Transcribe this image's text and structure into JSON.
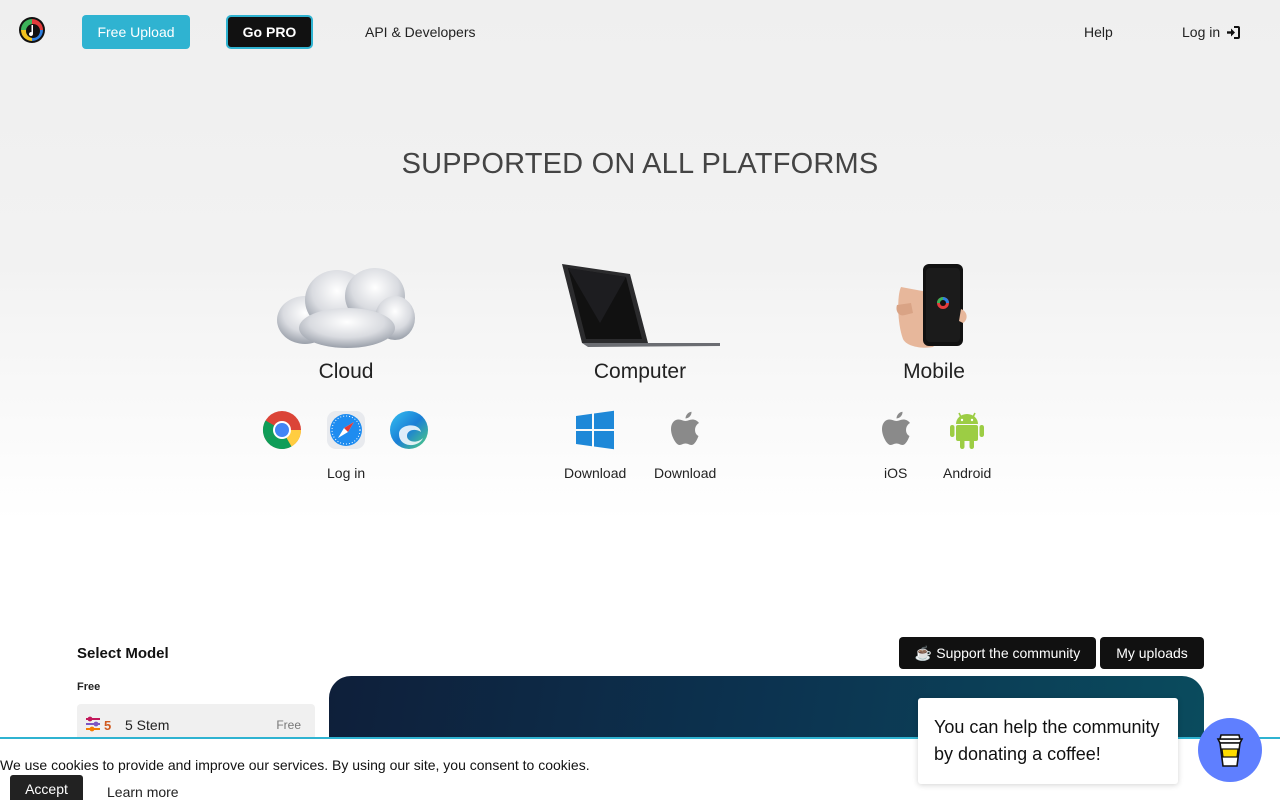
{
  "nav": {
    "free_upload": "Free Upload",
    "go_pro": "Go PRO",
    "api": "API & Developers",
    "help": "Help",
    "login": "Log in"
  },
  "hero": {
    "title": "SUPPORTED ON ALL PLATFORMS"
  },
  "platforms": {
    "cloud": {
      "label": "Cloud",
      "action": "Log in"
    },
    "computer": {
      "label": "Computer",
      "windows_action": "Download",
      "mac_action": "Download"
    },
    "mobile": {
      "label": "Mobile",
      "ios": "iOS",
      "android": "Android"
    }
  },
  "models": {
    "title": "Select Model",
    "group_free": "Free",
    "items": [
      {
        "count": "5",
        "name": "5 Stem",
        "tag": "Free"
      }
    ]
  },
  "actions": {
    "support": "Support the community",
    "support_icon": "☕",
    "uploads": "My uploads"
  },
  "cookie": {
    "text": "We use cookies to provide and improve our services. By using our site, you consent to cookies.",
    "accept": "Accept",
    "learn_more": "Learn more"
  },
  "donate": {
    "text": "You can help the community by donating a coffee!"
  },
  "colors": {
    "accent": "#2fb3d1",
    "dark": "#111111",
    "coffee": "#5f7fff"
  }
}
